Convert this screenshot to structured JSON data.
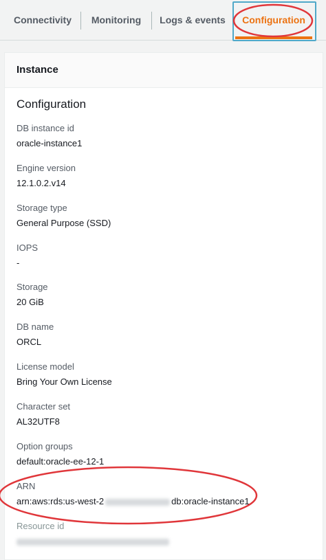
{
  "tabs": [
    {
      "label": "Connectivity"
    },
    {
      "label": "Monitoring"
    },
    {
      "label": "Logs & events"
    },
    {
      "label": "Configuration",
      "active": true
    }
  ],
  "panel": {
    "title": "Instance",
    "section_title": "Configuration"
  },
  "fields": {
    "db_instance_id": {
      "label": "DB instance id",
      "value": "oracle-instance1"
    },
    "engine_version": {
      "label": "Engine version",
      "value": "12.1.0.2.v14"
    },
    "storage_type": {
      "label": "Storage type",
      "value": "General Purpose (SSD)"
    },
    "iops": {
      "label": "IOPS",
      "value": "-"
    },
    "storage": {
      "label": "Storage",
      "value": "20 GiB"
    },
    "db_name": {
      "label": "DB name",
      "value": "ORCL"
    },
    "license_model": {
      "label": "License model",
      "value": "Bring Your Own License"
    },
    "character_set": {
      "label": "Character set",
      "value": "AL32UTF8"
    },
    "option_groups": {
      "label": "Option groups",
      "value": "default:oracle-ee-12-1"
    },
    "arn": {
      "label": "ARN",
      "value_prefix": "arn:aws:rds:us-west-2",
      "value_suffix": "db:oracle-instance1"
    },
    "resource_id": {
      "label": "Resource id"
    }
  },
  "colors": {
    "accent": "#ec7211",
    "annotation": "#e0363a",
    "tab_focus": "#4fa8c8"
  }
}
